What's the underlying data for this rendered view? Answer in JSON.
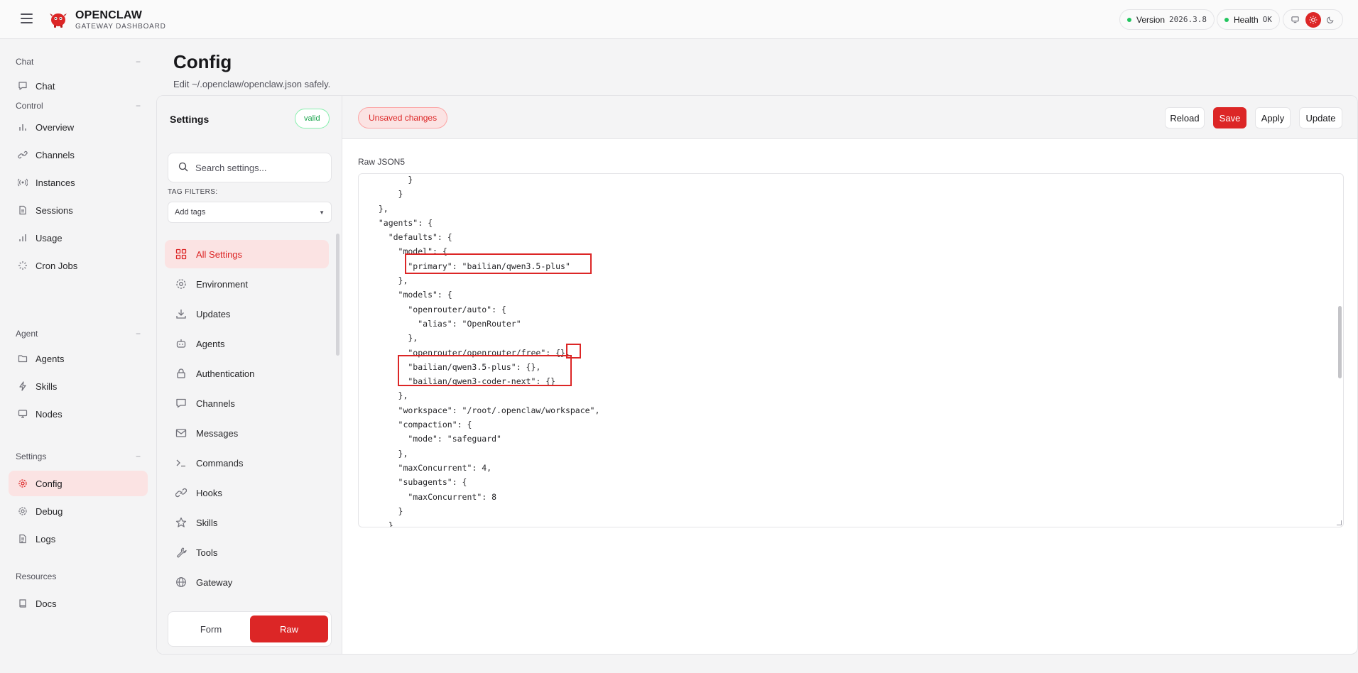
{
  "app": {
    "brand_title": "OPENCLAW",
    "brand_subtitle": "GATEWAY DASHBOARD",
    "version_label": "Version",
    "version_value": "2026.3.8",
    "health_label": "Health",
    "health_value": "OK",
    "accent": "#dc2626",
    "status_ok_color": "#22c55e"
  },
  "nav": {
    "sections": [
      {
        "label": "Chat",
        "items": [
          {
            "label": "Chat",
            "icon": "message-icon"
          }
        ]
      },
      {
        "label": "Control",
        "items": [
          {
            "label": "Overview",
            "icon": "bar-chart-icon"
          },
          {
            "label": "Channels",
            "icon": "link-icon"
          },
          {
            "label": "Instances",
            "icon": "radio-icon"
          },
          {
            "label": "Sessions",
            "icon": "file-icon"
          },
          {
            "label": "Usage",
            "icon": "bar-chart-icon"
          },
          {
            "label": "Cron Jobs",
            "icon": "loader-icon"
          }
        ]
      },
      {
        "label": "Agent",
        "items": [
          {
            "label": "Agents",
            "icon": "folder-icon"
          },
          {
            "label": "Skills",
            "icon": "zap-icon"
          },
          {
            "label": "Nodes",
            "icon": "monitor-icon"
          }
        ]
      },
      {
        "label": "Settings",
        "items": [
          {
            "label": "Config",
            "icon": "gear-icon"
          },
          {
            "label": "Debug",
            "icon": "bug-icon"
          },
          {
            "label": "Logs",
            "icon": "file-text-icon"
          }
        ]
      },
      {
        "label": "Resources",
        "items": [
          {
            "label": "Docs",
            "icon": "book-icon"
          }
        ]
      }
    ],
    "collapse_glyph": "−",
    "active": "Config"
  },
  "page": {
    "title": "Config",
    "subtitle": "Edit ~/.openclaw/openclaw.json safely."
  },
  "settings": {
    "title": "Settings",
    "status_badge": "valid",
    "search_placeholder": "Search settings...",
    "tag_filters_label": "TAG FILTERS:",
    "tag_placeholder": "Add tags",
    "sections": [
      {
        "label": "All Settings",
        "icon": "grid-icon"
      },
      {
        "label": "Environment",
        "icon": "gear-icon"
      },
      {
        "label": "Updates",
        "icon": "download-icon"
      },
      {
        "label": "Agents",
        "icon": "bot-icon"
      },
      {
        "label": "Authentication",
        "icon": "lock-icon"
      },
      {
        "label": "Channels",
        "icon": "message-icon"
      },
      {
        "label": "Messages",
        "icon": "mail-icon"
      },
      {
        "label": "Commands",
        "icon": "terminal-icon"
      },
      {
        "label": "Hooks",
        "icon": "link-icon"
      },
      {
        "label": "Skills",
        "icon": "star-icon"
      },
      {
        "label": "Tools",
        "icon": "wrench-icon"
      },
      {
        "label": "Gateway",
        "icon": "globe-icon"
      }
    ],
    "active_section": "All Settings",
    "mode_form": "Form",
    "mode_raw": "Raw",
    "active_mode": "Raw"
  },
  "editor": {
    "unsaved_label": "Unsaved changes",
    "buttons": {
      "reload": "Reload",
      "save": "Save",
      "apply": "Apply",
      "update": "Update"
    },
    "raw_label": "Raw JSON5",
    "lines": [
      "        }",
      "      }",
      "  },",
      "  \"agents\": {",
      "    \"defaults\": {",
      "      \"model\": {",
      "        \"primary\": \"bailian/qwen3.5-plus\"",
      "      },",
      "      \"models\": {",
      "        \"openrouter/auto\": {",
      "          \"alias\": \"OpenRouter\"",
      "        },",
      "        \"openrouter/openrouter/free\": {},",
      "        \"bailian/qwen3.5-plus\": {},",
      "        \"bailian/qwen3-coder-next\": {}",
      "      },",
      "      \"workspace\": \"/root/.openclaw/workspace\",",
      "      \"compaction\": {",
      "        \"mode\": \"safeguard\"",
      "      },",
      "      \"maxConcurrent\": 4,",
      "      \"subagents\": {",
      "        \"maxConcurrent\": 8",
      "      }",
      "    }"
    ]
  }
}
